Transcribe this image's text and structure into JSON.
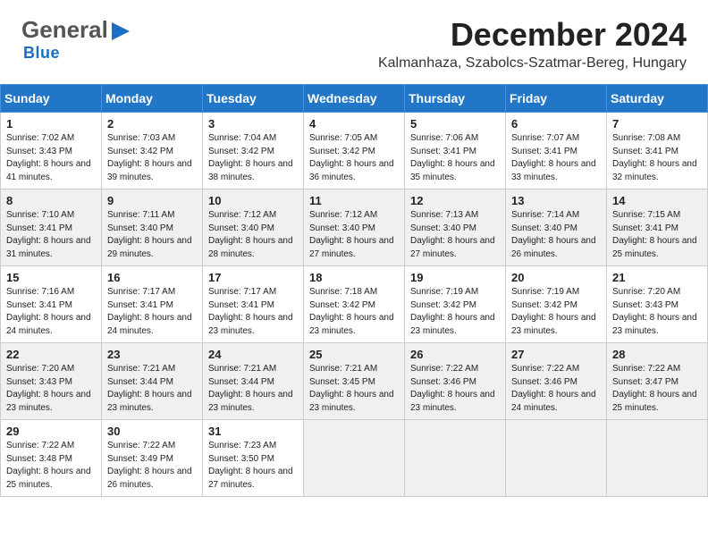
{
  "header": {
    "logo_general": "General",
    "logo_blue": "Blue",
    "title": "December 2024",
    "subtitle": "Kalmanhaza, Szabolcs-Szatmar-Bereg, Hungary"
  },
  "days_of_week": [
    "Sunday",
    "Monday",
    "Tuesday",
    "Wednesday",
    "Thursday",
    "Friday",
    "Saturday"
  ],
  "weeks": [
    [
      {
        "day": "1",
        "sunrise": "Sunrise: 7:02 AM",
        "sunset": "Sunset: 3:43 PM",
        "daylight": "Daylight: 8 hours and 41 minutes."
      },
      {
        "day": "2",
        "sunrise": "Sunrise: 7:03 AM",
        "sunset": "Sunset: 3:42 PM",
        "daylight": "Daylight: 8 hours and 39 minutes."
      },
      {
        "day": "3",
        "sunrise": "Sunrise: 7:04 AM",
        "sunset": "Sunset: 3:42 PM",
        "daylight": "Daylight: 8 hours and 38 minutes."
      },
      {
        "day": "4",
        "sunrise": "Sunrise: 7:05 AM",
        "sunset": "Sunset: 3:42 PM",
        "daylight": "Daylight: 8 hours and 36 minutes."
      },
      {
        "day": "5",
        "sunrise": "Sunrise: 7:06 AM",
        "sunset": "Sunset: 3:41 PM",
        "daylight": "Daylight: 8 hours and 35 minutes."
      },
      {
        "day": "6",
        "sunrise": "Sunrise: 7:07 AM",
        "sunset": "Sunset: 3:41 PM",
        "daylight": "Daylight: 8 hours and 33 minutes."
      },
      {
        "day": "7",
        "sunrise": "Sunrise: 7:08 AM",
        "sunset": "Sunset: 3:41 PM",
        "daylight": "Daylight: 8 hours and 32 minutes."
      }
    ],
    [
      {
        "day": "8",
        "sunrise": "Sunrise: 7:10 AM",
        "sunset": "Sunset: 3:41 PM",
        "daylight": "Daylight: 8 hours and 31 minutes."
      },
      {
        "day": "9",
        "sunrise": "Sunrise: 7:11 AM",
        "sunset": "Sunset: 3:40 PM",
        "daylight": "Daylight: 8 hours and 29 minutes."
      },
      {
        "day": "10",
        "sunrise": "Sunrise: 7:12 AM",
        "sunset": "Sunset: 3:40 PM",
        "daylight": "Daylight: 8 hours and 28 minutes."
      },
      {
        "day": "11",
        "sunrise": "Sunrise: 7:12 AM",
        "sunset": "Sunset: 3:40 PM",
        "daylight": "Daylight: 8 hours and 27 minutes."
      },
      {
        "day": "12",
        "sunrise": "Sunrise: 7:13 AM",
        "sunset": "Sunset: 3:40 PM",
        "daylight": "Daylight: 8 hours and 27 minutes."
      },
      {
        "day": "13",
        "sunrise": "Sunrise: 7:14 AM",
        "sunset": "Sunset: 3:40 PM",
        "daylight": "Daylight: 8 hours and 26 minutes."
      },
      {
        "day": "14",
        "sunrise": "Sunrise: 7:15 AM",
        "sunset": "Sunset: 3:41 PM",
        "daylight": "Daylight: 8 hours and 25 minutes."
      }
    ],
    [
      {
        "day": "15",
        "sunrise": "Sunrise: 7:16 AM",
        "sunset": "Sunset: 3:41 PM",
        "daylight": "Daylight: 8 hours and 24 minutes."
      },
      {
        "day": "16",
        "sunrise": "Sunrise: 7:17 AM",
        "sunset": "Sunset: 3:41 PM",
        "daylight": "Daylight: 8 hours and 24 minutes."
      },
      {
        "day": "17",
        "sunrise": "Sunrise: 7:17 AM",
        "sunset": "Sunset: 3:41 PM",
        "daylight": "Daylight: 8 hours and 23 minutes."
      },
      {
        "day": "18",
        "sunrise": "Sunrise: 7:18 AM",
        "sunset": "Sunset: 3:42 PM",
        "daylight": "Daylight: 8 hours and 23 minutes."
      },
      {
        "day": "19",
        "sunrise": "Sunrise: 7:19 AM",
        "sunset": "Sunset: 3:42 PM",
        "daylight": "Daylight: 8 hours and 23 minutes."
      },
      {
        "day": "20",
        "sunrise": "Sunrise: 7:19 AM",
        "sunset": "Sunset: 3:42 PM",
        "daylight": "Daylight: 8 hours and 23 minutes."
      },
      {
        "day": "21",
        "sunrise": "Sunrise: 7:20 AM",
        "sunset": "Sunset: 3:43 PM",
        "daylight": "Daylight: 8 hours and 23 minutes."
      }
    ],
    [
      {
        "day": "22",
        "sunrise": "Sunrise: 7:20 AM",
        "sunset": "Sunset: 3:43 PM",
        "daylight": "Daylight: 8 hours and 23 minutes."
      },
      {
        "day": "23",
        "sunrise": "Sunrise: 7:21 AM",
        "sunset": "Sunset: 3:44 PM",
        "daylight": "Daylight: 8 hours and 23 minutes."
      },
      {
        "day": "24",
        "sunrise": "Sunrise: 7:21 AM",
        "sunset": "Sunset: 3:44 PM",
        "daylight": "Daylight: 8 hours and 23 minutes."
      },
      {
        "day": "25",
        "sunrise": "Sunrise: 7:21 AM",
        "sunset": "Sunset: 3:45 PM",
        "daylight": "Daylight: 8 hours and 23 minutes."
      },
      {
        "day": "26",
        "sunrise": "Sunrise: 7:22 AM",
        "sunset": "Sunset: 3:46 PM",
        "daylight": "Daylight: 8 hours and 23 minutes."
      },
      {
        "day": "27",
        "sunrise": "Sunrise: 7:22 AM",
        "sunset": "Sunset: 3:46 PM",
        "daylight": "Daylight: 8 hours and 24 minutes."
      },
      {
        "day": "28",
        "sunrise": "Sunrise: 7:22 AM",
        "sunset": "Sunset: 3:47 PM",
        "daylight": "Daylight: 8 hours and 25 minutes."
      }
    ],
    [
      {
        "day": "29",
        "sunrise": "Sunrise: 7:22 AM",
        "sunset": "Sunset: 3:48 PM",
        "daylight": "Daylight: 8 hours and 25 minutes."
      },
      {
        "day": "30",
        "sunrise": "Sunrise: 7:22 AM",
        "sunset": "Sunset: 3:49 PM",
        "daylight": "Daylight: 8 hours and 26 minutes."
      },
      {
        "day": "31",
        "sunrise": "Sunrise: 7:23 AM",
        "sunset": "Sunset: 3:50 PM",
        "daylight": "Daylight: 8 hours and 27 minutes."
      },
      null,
      null,
      null,
      null
    ]
  ]
}
